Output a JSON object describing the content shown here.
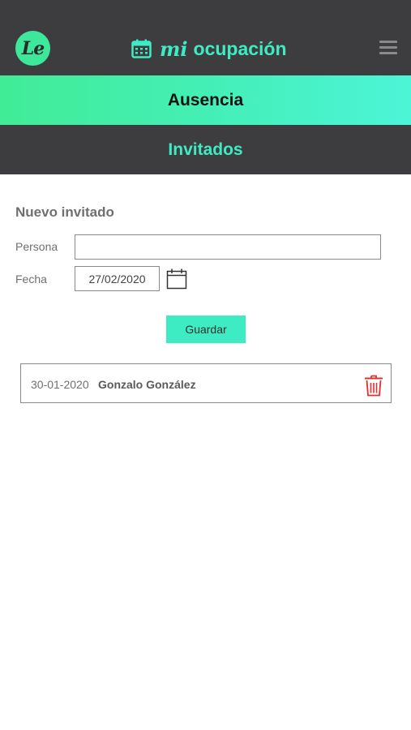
{
  "header": {
    "logo_text": "Le",
    "title_prefix": "mi",
    "title": "ocupación",
    "title_icon": "calendar-icon",
    "menu_icon": "hamburger-menu-icon"
  },
  "tabs": {
    "ausencia": "Ausencia",
    "invitados": "Invitados"
  },
  "form": {
    "section_title": "Nuevo invitado",
    "persona_label": "Persona",
    "persona_value": "",
    "fecha_label": "Fecha",
    "fecha_value": "27/02/2020",
    "date_picker_icon": "calendar-icon",
    "save_label": "Guardar"
  },
  "guests": [
    {
      "date": "30-01-2020",
      "name": "Gonzalo González",
      "delete_icon": "trash-icon"
    }
  ],
  "colors": {
    "accent": "#3eecc3",
    "header_bg": "#3d3d3f",
    "logo_green": "#3ee89a",
    "delete_red": "#e0302f"
  }
}
